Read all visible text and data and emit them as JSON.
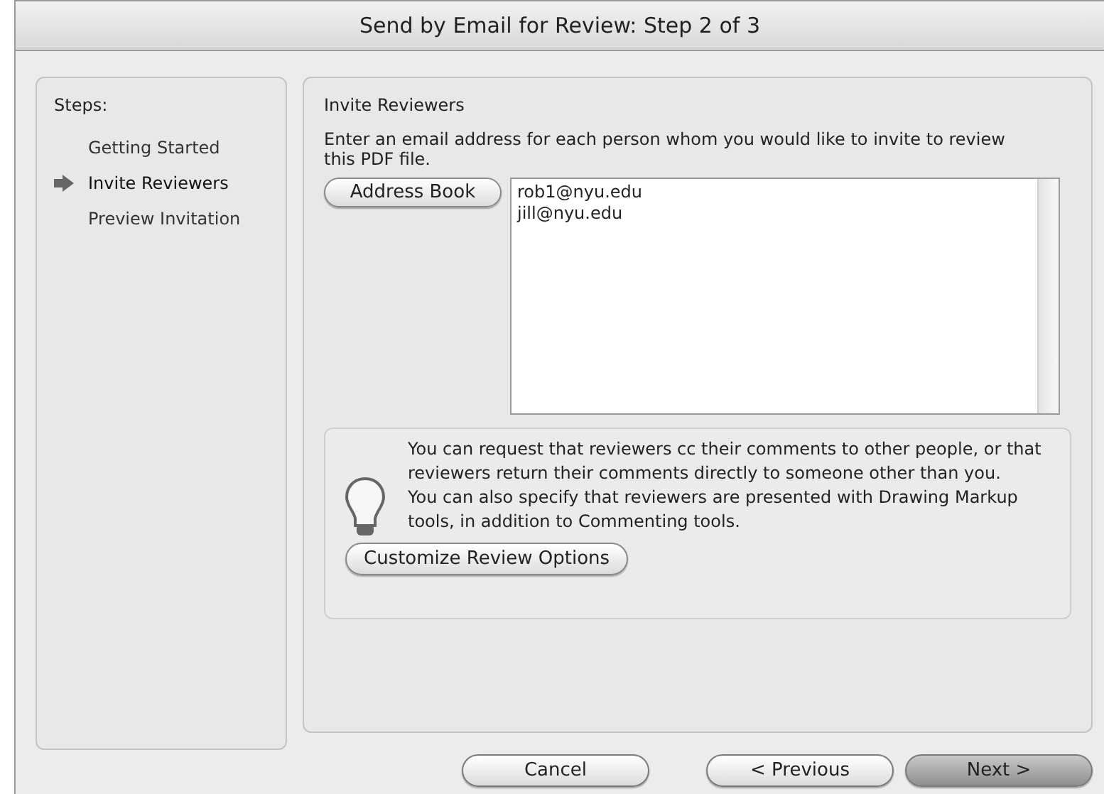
{
  "window": {
    "title": "Send by Email for Review: Step 2 of 3"
  },
  "sidebar": {
    "heading": "Steps:",
    "steps": [
      {
        "label": "Getting Started",
        "selected": false
      },
      {
        "label": "Invite Reviewers",
        "selected": true
      },
      {
        "label": "Preview Invitation",
        "selected": false
      }
    ]
  },
  "main": {
    "heading": "Invite Reviewers",
    "instructions": "Enter an email address for each person whom you would like to invite to review this PDF file.",
    "address_book_button": "Address Book",
    "recipients": [
      "rob1@nyu.edu",
      "jill@nyu.edu"
    ],
    "tip": {
      "paragraphs": [
        "You can request that reviewers cc their comments to other people, or that reviewers return their comments directly to someone other than you.",
        "You can also specify that reviewers are presented with Drawing Markup tools, in addition to Commenting tools."
      ],
      "button": "Customize Review Options"
    }
  },
  "buttons": [
    {
      "label": "Cancel",
      "kind": "normal"
    },
    {
      "label": "< Previous",
      "kind": "normal"
    },
    {
      "label": "Next >",
      "kind": "default"
    }
  ]
}
